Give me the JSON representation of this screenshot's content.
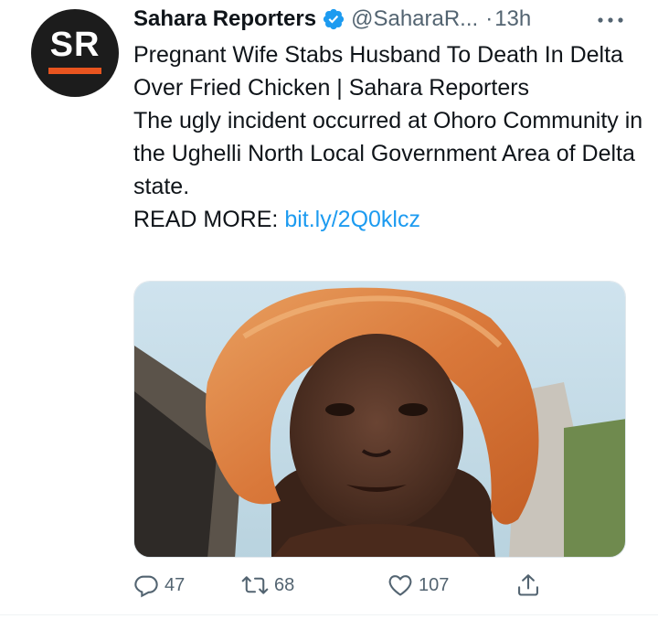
{
  "avatar": {
    "initials": "SR",
    "brand_color": "#e8541f",
    "background": "#1c1c1c"
  },
  "author": {
    "display_name": "Sahara Reporters",
    "handle": "@SaharaR...",
    "separator": "·",
    "time": "13h"
  },
  "tweet": {
    "headline": "Pregnant Wife Stabs Husband To Death In Delta Over Fried Chicken | Sahara Reporters",
    "body": "The ugly incident occurred at Ohoro Community in the Ughelli North Local Government Area of Delta state.",
    "read_more_label": "READ MORE:",
    "link_text": "bit.ly/2Q0klcz"
  },
  "actions": {
    "reply_count": "47",
    "retweet_count": "68",
    "like_count": "107"
  },
  "colors": {
    "link": "#1d9bf0",
    "verified": "#1d9bf0",
    "muted": "#536471"
  }
}
